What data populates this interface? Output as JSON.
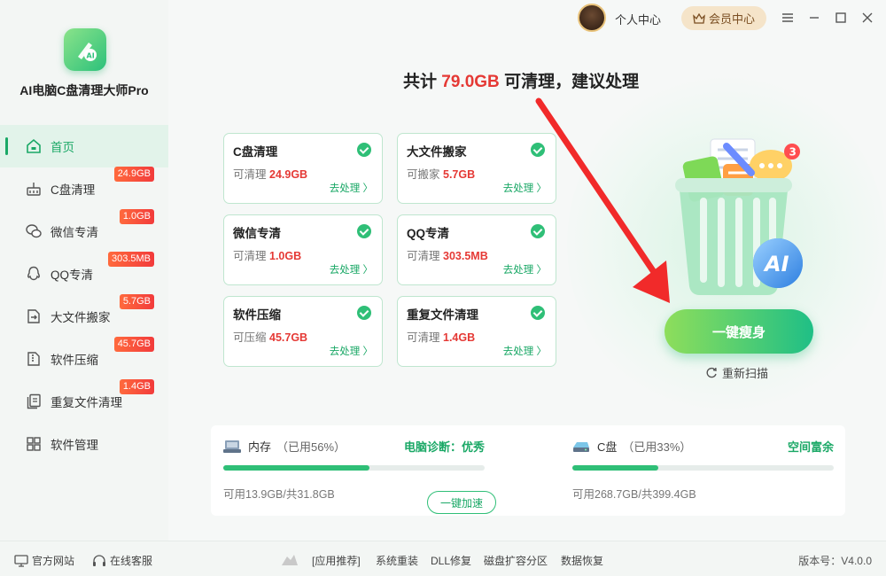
{
  "app": {
    "name": "AI电脑C盘清理大师Pro"
  },
  "topbar": {
    "personal_center": "个人中心",
    "vip_center": "会员中心"
  },
  "headline": {
    "prefix": "共计",
    "amount": "79.0GB",
    "suffix": "可清理，建议处理"
  },
  "sidebar": {
    "items": [
      {
        "label": "首页",
        "badge": ""
      },
      {
        "label": "C盘清理",
        "badge": "24.9GB"
      },
      {
        "label": "微信专清",
        "badge": "1.0GB"
      },
      {
        "label": "QQ专清",
        "badge": "303.5MB"
      },
      {
        "label": "大文件搬家",
        "badge": "5.7GB"
      },
      {
        "label": "软件压缩",
        "badge": "45.7GB"
      },
      {
        "label": "重复文件清理",
        "badge": "1.4GB"
      },
      {
        "label": "软件管理",
        "badge": ""
      }
    ]
  },
  "cards": [
    {
      "title": "C盘清理",
      "label": "可清理",
      "value": "24.9GB",
      "action": "去处理 〉"
    },
    {
      "title": "大文件搬家",
      "label": "可搬家",
      "value": "5.7GB",
      "action": "去处理 〉"
    },
    {
      "title": "微信专清",
      "label": "可清理",
      "value": "1.0GB",
      "action": "去处理 〉"
    },
    {
      "title": "QQ专清",
      "label": "可清理",
      "value": "303.5MB",
      "action": "去处理 〉"
    },
    {
      "title": "软件压缩",
      "label": "可压缩",
      "value": "45.7GB",
      "action": "去处理 〉"
    },
    {
      "title": "重复文件清理",
      "label": "可清理",
      "value": "1.4GB",
      "action": "去处理 〉"
    }
  ],
  "main": {
    "cta_label": "一键瘦身",
    "rescan_label": "重新扫描",
    "bin_badge": "3"
  },
  "stats": {
    "memory": {
      "name": "内存",
      "used_text": "（已用56%）",
      "status": "电脑诊断：优秀",
      "used_percent": 56,
      "sub": "可用13.9GB/共31.8GB",
      "button": "一键加速"
    },
    "disk": {
      "name": "C盘",
      "used_text": "（已用33%）",
      "status": "空间富余",
      "used_percent": 33,
      "sub": "可用268.7GB/共399.4GB"
    }
  },
  "footer": {
    "official_site": "官方网站",
    "online_service": "在线客服",
    "links": [
      "[应用推荐]",
      "系统重装",
      "DLL修复",
      "磁盘扩容分区",
      "数据恢复"
    ],
    "version": "版本号：V4.0.0"
  },
  "colors": {
    "accent": "#1aa866",
    "danger": "#e53935",
    "badge": "#f23b3b",
    "vip_bg": "#f5e4c9"
  }
}
